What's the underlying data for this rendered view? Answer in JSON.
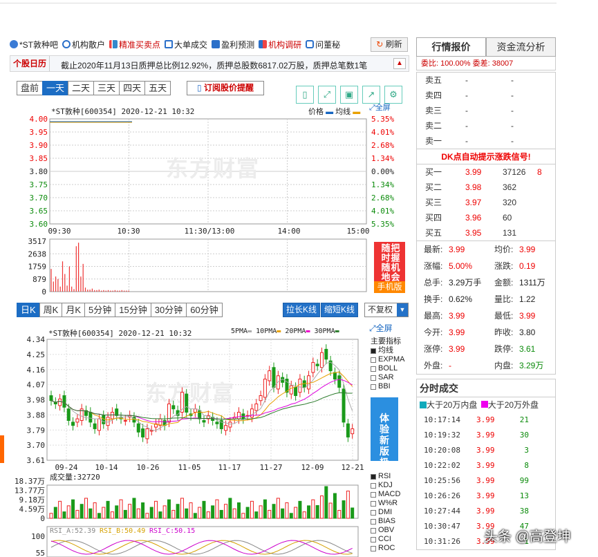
{
  "links": [
    "*ST敦种吧",
    "机构散户",
    "精准买卖点",
    "大单成交",
    "盈利预测",
    "机构调研",
    "问董秘"
  ],
  "refresh": "刷新",
  "notice": {
    "tag": "个股日历",
    "text": "截止2020年11月13日质押总比例12.92%，质押总股数6817.02万股，质押总笔数1笔"
  },
  "periods": [
    "盘前",
    "一天",
    "二天",
    "三天",
    "四天",
    "五天"
  ],
  "remind": "订阅股价提醒",
  "intraday": {
    "header": "*ST敦种[600354] 2020-12-21 10:32",
    "legend_price": "价格",
    "legend_avg": "均线",
    "fullscreen": "全屏",
    "price_ticks": [
      "4.00",
      "3.95",
      "3.90",
      "3.85",
      "3.80",
      "3.75",
      "3.70",
      "3.65",
      "3.60"
    ],
    "pct_ticks": [
      "5.35%",
      "4.01%",
      "2.68%",
      "1.34%",
      "0.00%",
      "1.34%",
      "2.68%",
      "4.01%",
      "5.35%"
    ],
    "time_ticks": [
      "09:30",
      "10:30",
      "11:30/13:00",
      "14:00",
      "15:00"
    ],
    "vol_ticks": [
      "3517",
      "2638",
      "1759",
      "879",
      "0"
    ],
    "watermark": "东方财富"
  },
  "promo": {
    "text": "把握机会随时随地",
    "sub": "手机版"
  },
  "ktabs": [
    "日K",
    "周K",
    "月K",
    "5分钟",
    "15分钟",
    "30分钟",
    "60分钟"
  ],
  "kbtns": {
    "longer": "拉长K线",
    "shorter": "缩短K线",
    "fq": "不复权"
  },
  "kchart": {
    "header": "*ST敦种[600354] 2020-12-21 10:32",
    "ma_legend": [
      "5PMA",
      "10PMA",
      "20PMA",
      "30PMA"
    ],
    "fullscreen": "全屏",
    "price_ticks": [
      "4.34",
      "4.25",
      "4.16",
      "4.07",
      "3.98",
      "3.88",
      "3.79",
      "3.70",
      "3.61"
    ],
    "date_ticks": [
      "09-24",
      "10-14",
      "10-26",
      "11-05",
      "11-17",
      "11-27",
      "12-09",
      "12-21"
    ],
    "indicators_title": "主要指标",
    "indicators": [
      "均线",
      "EXPMA",
      "BOLL",
      "SAR",
      "BBI"
    ],
    "vol_label": "成交量:32720",
    "vol_ticks": [
      "18.37万",
      "13.77万",
      "9.18万",
      "4.59万",
      "0"
    ],
    "sub_ind": [
      "RSI",
      "KDJ",
      "MACD",
      "W%R",
      "DMI",
      "BIAS",
      "OBV",
      "CCI",
      "ROC"
    ],
    "rsi_label": {
      "a": "RSI_A:52.39",
      "b": "RSI_B:50.49",
      "c": "RSI_C:50.15"
    },
    "rsi_ticks": [
      "100",
      "55"
    ],
    "tiyan": "体验新版极速行情"
  },
  "chart_data": {
    "type": "candlestick",
    "title": "*ST敦种[600354] 2020-12-21 10:32",
    "intraday": {
      "x": [
        "09:30",
        "10:30"
      ],
      "price": [
        3.99,
        3.99
      ],
      "prev_close": 3.8,
      "ylim": [
        3.6,
        4.0
      ]
    },
    "daily": {
      "dates": [
        "09-24",
        "10-14",
        "10-26",
        "11-05",
        "11-17",
        "11-27",
        "12-09",
        "12-21"
      ],
      "ylim": [
        3.61,
        4.34
      ],
      "last_close": 3.99,
      "volume": 32720
    }
  },
  "quote": {
    "tabs": [
      "行情报价",
      "资金流分析"
    ],
    "webi": "委比: 100.00% 委差: 38007",
    "asks": [
      {
        "k": "卖五",
        "p": "-",
        "v": "-"
      },
      {
        "k": "卖四",
        "p": "-",
        "v": "-"
      },
      {
        "k": "卖三",
        "p": "-",
        "v": "-"
      },
      {
        "k": "卖二",
        "p": "-",
        "v": "-"
      },
      {
        "k": "卖一",
        "p": "-",
        "v": "-"
      }
    ],
    "dk": "DK点自动提示涨跌信号!",
    "bids": [
      {
        "k": "买一",
        "p": "3.99",
        "v": "37126",
        "x": "8"
      },
      {
        "k": "买二",
        "p": "3.98",
        "v": "362",
        "x": ""
      },
      {
        "k": "买三",
        "p": "3.97",
        "v": "320",
        "x": ""
      },
      {
        "k": "买四",
        "p": "3.96",
        "v": "60",
        "x": ""
      },
      {
        "k": "买五",
        "p": "3.95",
        "v": "131",
        "x": ""
      }
    ],
    "stats": [
      [
        "最新:",
        "3.99",
        "均价:",
        "3.99"
      ],
      [
        "涨幅:",
        "5.00%",
        "涨跌:",
        "0.19"
      ],
      [
        "总手:",
        "3.29万手",
        "金额:",
        "1311万"
      ],
      [
        "换手:",
        "0.62%",
        "量比:",
        "1.22"
      ],
      [
        "最高:",
        "3.99",
        "最低:",
        "3.99"
      ],
      [
        "今开:",
        "3.99",
        "昨收:",
        "3.80"
      ],
      [
        "涨停:",
        "3.99",
        "跌停:",
        "3.61"
      ],
      [
        "外盘:",
        "-",
        "内盘:",
        "3.29万"
      ]
    ]
  },
  "trades": {
    "title": "分时成交",
    "legend_a": "大于20万内盘",
    "legend_b": "大于20万外盘",
    "rows": [
      [
        "10:17:14",
        "3.99",
        "21"
      ],
      [
        "10:19:32",
        "3.99",
        "30"
      ],
      [
        "10:20:08",
        "3.99",
        "3"
      ],
      [
        "10:22:02",
        "3.99",
        "8"
      ],
      [
        "10:25:56",
        "3.99",
        "99"
      ],
      [
        "10:26:26",
        "3.99",
        "13"
      ],
      [
        "10:27:44",
        "3.99",
        "38"
      ],
      [
        "10:30:47",
        "3.99",
        "47"
      ],
      [
        "10:31:26",
        "3.99",
        "1"
      ]
    ]
  },
  "overlay": "头条 @高登坤"
}
